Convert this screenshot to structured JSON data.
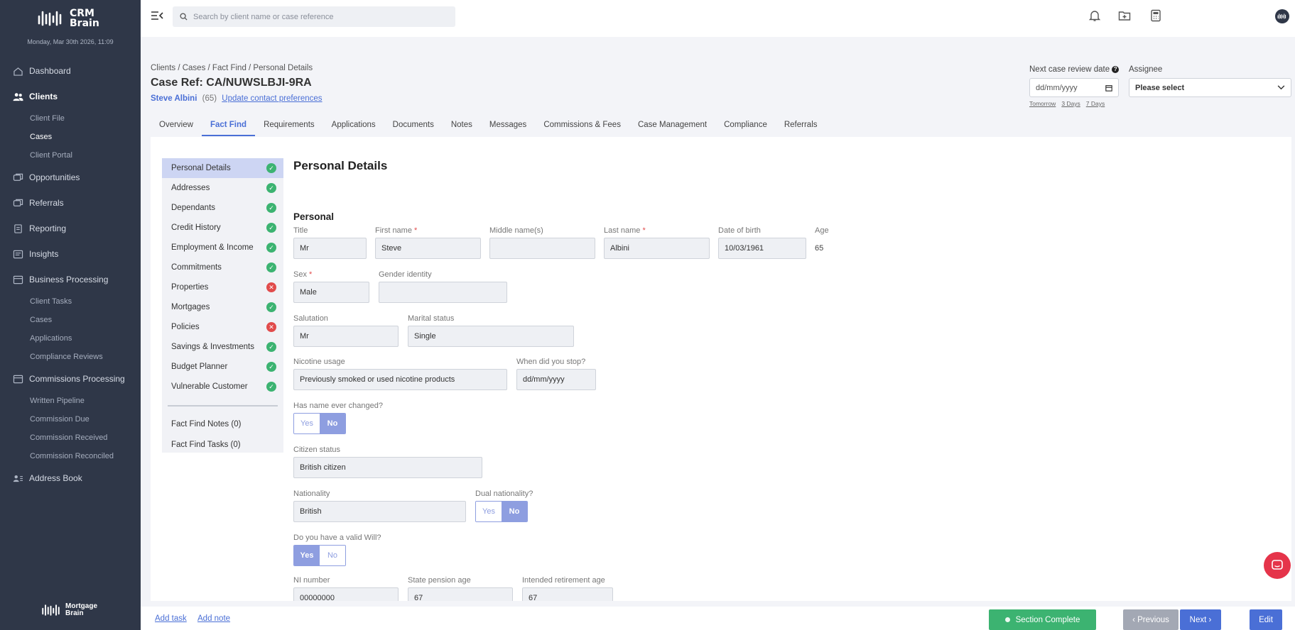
{
  "app": {
    "logo_text_1": "CRM",
    "logo_text_2": "Brain",
    "date": "Monday, Mar 30th 2026, 11:09",
    "footer_logo_1": "Mortgage",
    "footer_logo_2": "Brain"
  },
  "sidebar": {
    "items": [
      {
        "label": "Dashboard",
        "icon": "home-icon"
      },
      {
        "label": "Clients",
        "icon": "users-icon",
        "sub": [
          "Client File",
          "Cases",
          "Client Portal"
        ]
      },
      {
        "label": "Opportunities",
        "icon": "chat-icon"
      },
      {
        "label": "Referrals",
        "icon": "referral-icon"
      },
      {
        "label": "Reporting",
        "icon": "document-icon"
      },
      {
        "label": "Insights",
        "icon": "chart-icon"
      },
      {
        "label": "Business Processing",
        "icon": "briefcase-icon",
        "sub": [
          "Client Tasks",
          "Cases",
          "Applications",
          "Compliance Reviews"
        ]
      },
      {
        "label": "Commissions Processing",
        "icon": "wallet-icon",
        "sub": [
          "Written Pipeline",
          "Commission Due",
          "Commission Received",
          "Commission Reconciled"
        ]
      },
      {
        "label": "Address Book",
        "icon": "contacts-icon"
      }
    ]
  },
  "topbar": {
    "search_placeholder": "Search by client name or case reference"
  },
  "header": {
    "breadcrumb": "Clients / Cases / Fact Find / Personal Details",
    "case_ref": "Case Ref: CA/NUWSLBJI-9RA",
    "client_name": "Steve Albini",
    "client_age": "(65)",
    "contact_link": "Update contact preferences",
    "review_label": "Next case review date",
    "review_placeholder": "dd/mm/yyyy",
    "quick_dates": [
      "Tomorrow",
      "3 Days",
      "7 Days"
    ],
    "assignee_label": "Assignee",
    "assignee_value": "Please select"
  },
  "tabs": [
    "Overview",
    "Fact Find",
    "Requirements",
    "Applications",
    "Documents",
    "Notes",
    "Messages",
    "Commissions & Fees",
    "Case Management",
    "Compliance",
    "Referrals"
  ],
  "fact_find_nav": {
    "items": [
      {
        "label": "Personal Details",
        "status": "complete"
      },
      {
        "label": "Addresses",
        "status": "complete"
      },
      {
        "label": "Dependants",
        "status": "complete"
      },
      {
        "label": "Credit History",
        "status": "complete"
      },
      {
        "label": "Employment & Income",
        "status": "complete"
      },
      {
        "label": "Commitments",
        "status": "complete"
      },
      {
        "label": "Properties",
        "status": "incomplete"
      },
      {
        "label": "Mortgages",
        "status": "complete"
      },
      {
        "label": "Policies",
        "status": "incomplete"
      },
      {
        "label": "Savings & Investments",
        "status": "complete"
      },
      {
        "label": "Budget Planner",
        "status": "complete"
      },
      {
        "label": "Vulnerable Customer",
        "status": "complete"
      }
    ],
    "notes_link": "Fact Find Notes (0)",
    "tasks_link": "Fact Find Tasks (0)"
  },
  "form": {
    "section_title": "Personal Details",
    "subsection_title": "Personal",
    "title": {
      "label": "Title",
      "value": "Mr"
    },
    "first_name": {
      "label": "First name",
      "value": "Steve"
    },
    "middle_name": {
      "label": "Middle name(s)",
      "value": ""
    },
    "last_name": {
      "label": "Last name",
      "value": "Albini"
    },
    "dob": {
      "label": "Date of birth",
      "value": "10/03/1961"
    },
    "age": {
      "label": "Age",
      "value": "65"
    },
    "sex": {
      "label": "Sex",
      "value": "Male"
    },
    "gender_identity": {
      "label": "Gender identity",
      "value": ""
    },
    "salutation": {
      "label": "Salutation",
      "value": "Mr"
    },
    "marital_status": {
      "label": "Marital status",
      "value": "Single"
    },
    "nicotine": {
      "label": "Nicotine usage",
      "value": "Previously smoked or used nicotine products"
    },
    "stopped": {
      "label": "When did you stop?",
      "value": "dd/mm/yyyy"
    },
    "name_changed": {
      "label": "Has name ever changed?",
      "yes": "Yes",
      "no": "No",
      "selected": "No"
    },
    "citizen_status": {
      "label": "Citizen status",
      "value": "British citizen"
    },
    "nationality": {
      "label": "Nationality",
      "value": "British"
    },
    "dual_nationality": {
      "label": "Dual nationality?",
      "yes": "Yes",
      "no": "No",
      "selected": "No"
    },
    "valid_will": {
      "label": "Do you have a valid Will?",
      "yes": "Yes",
      "no": "No",
      "selected": "Yes"
    },
    "ni_number": {
      "label": "NI number",
      "value": "00000000"
    },
    "state_pension_age": {
      "label": "State pension age",
      "value": "67"
    },
    "retirement_age": {
      "label": "Intended retirement age",
      "value": "67"
    }
  },
  "footer": {
    "add_task": "Add task",
    "add_note": "Add note",
    "section_complete": "Section Complete",
    "previous": "‹  Previous",
    "next": "Next  ›",
    "edit": "Edit"
  },
  "colors": {
    "sidebar_bg": "#2f3748",
    "accent": "#4a6fd6",
    "success": "#3cb371",
    "danger": "#e14b4b",
    "chat": "#e5344a"
  }
}
